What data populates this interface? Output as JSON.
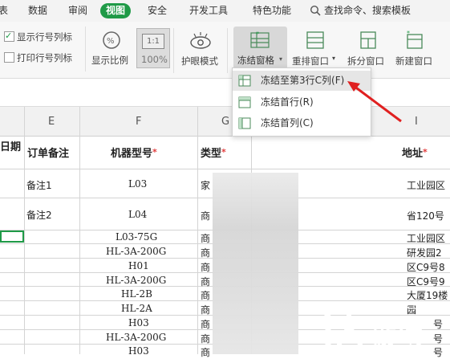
{
  "menu": {
    "tabs": [
      {
        "label": "表"
      },
      {
        "label": "数据"
      },
      {
        "label": "审阅"
      },
      {
        "label": "视图",
        "active": true
      },
      {
        "label": "安全"
      },
      {
        "label": "开发工具"
      },
      {
        "label": "特色功能"
      }
    ],
    "search_label": "查找命令、搜索模板"
  },
  "toolbar": {
    "show_row_col_header": "显示行号列标",
    "print_row_col_header": "打印行号列标",
    "show_zoom_label": "显示比例",
    "zoom_box_text": "1:1",
    "zoom_value": "100%",
    "eye_mode_label": "护眼模式",
    "freeze_label": "冻结窗格",
    "arrange_label": "重排窗口",
    "split_label": "拆分窗口",
    "new_window_label": "新建窗口"
  },
  "freeze_menu": {
    "items": [
      {
        "label": "冻结至第3行C列(F)"
      },
      {
        "label": "冻结首行(R)"
      },
      {
        "label": "冻结首列(C)"
      }
    ]
  },
  "sheet": {
    "columns": [
      "E",
      "F",
      "G",
      "I"
    ],
    "headers": {
      "d": "日期",
      "e": "订单备注",
      "f": "机器型号",
      "g": "类型",
      "i": "地址",
      "required_mark": "*"
    },
    "rows": [
      {
        "e": "备注1",
        "f": "L03",
        "g": "家",
        "i": "工业园区"
      },
      {
        "e": "备注2",
        "f": "L04",
        "g": "商",
        "i": "省120号"
      },
      {
        "e": "",
        "f": "L03-75G",
        "g": "商",
        "i": "工业园区"
      },
      {
        "e": "",
        "f": "HL-3A-200G",
        "g": "商",
        "i": "研发园2"
      },
      {
        "e": "",
        "f": "H01",
        "g": "商",
        "i": "区C9号8"
      },
      {
        "e": "",
        "f": "HL-3A-200G",
        "g": "商",
        "i": "区C9号9"
      },
      {
        "e": "",
        "f": "HL-2B",
        "g": "商",
        "i": "大厦19楼"
      },
      {
        "e": "",
        "f": "HL-2A",
        "g": "商",
        "i": "园"
      },
      {
        "e": "",
        "f": "H03",
        "g": "商",
        "i": "号"
      },
      {
        "e": "",
        "f": "HL-3A-200G",
        "g": "商",
        "i": "号"
      },
      {
        "e": "",
        "f": "H03",
        "g": "商",
        "i": "号"
      }
    ]
  },
  "watermark": {
    "site": "xiayx.com",
    "brand": "游戏"
  },
  "colors": {
    "accent": "#1f9a47",
    "arrow": "#e02020",
    "required": "#e23b3b"
  }
}
